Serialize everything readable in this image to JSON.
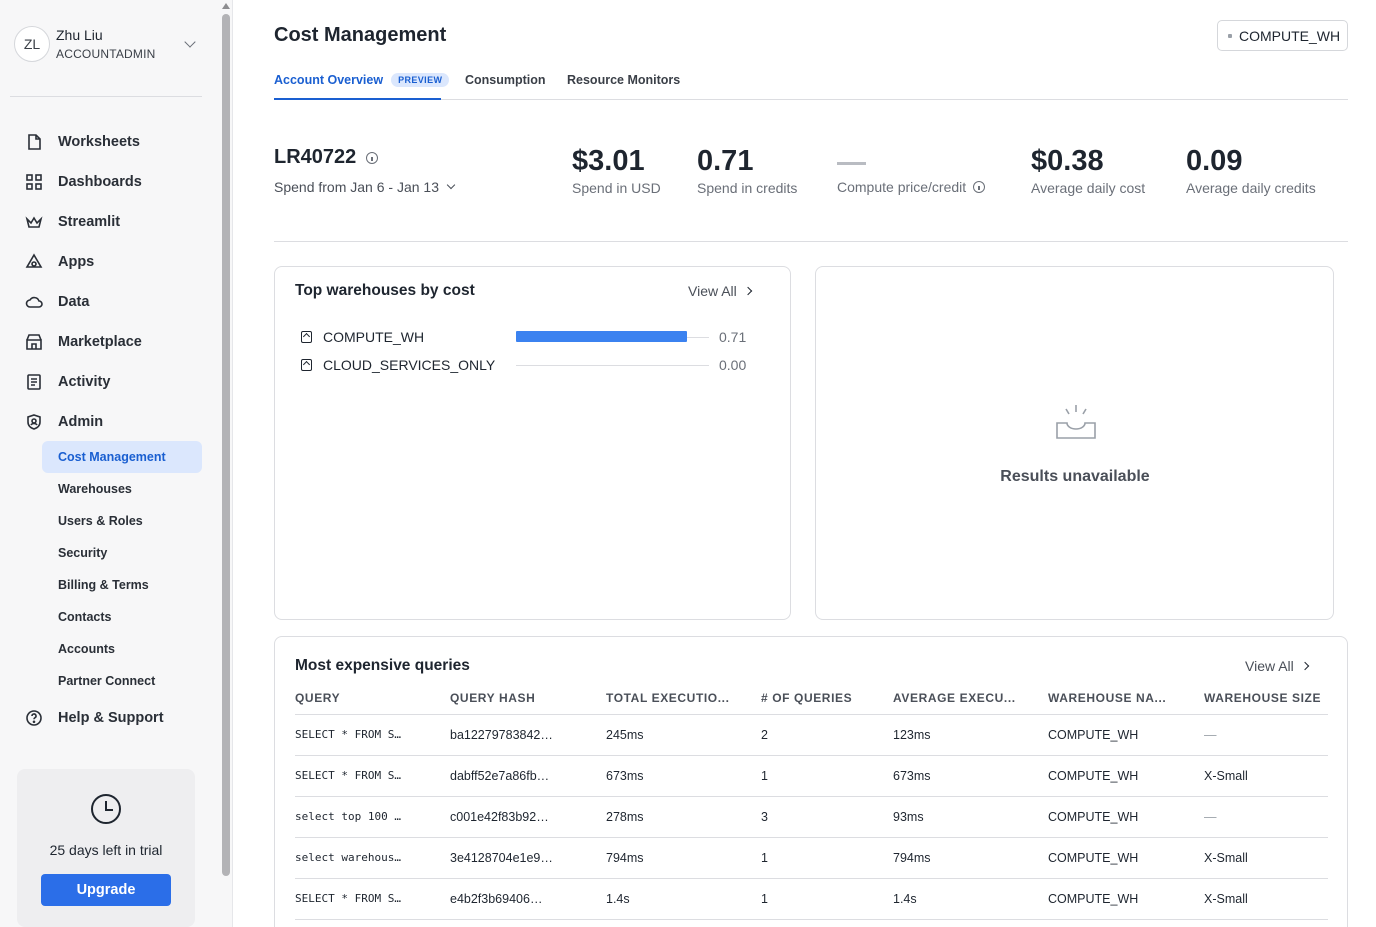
{
  "user": {
    "initials": "ZL",
    "name": "Zhu Liu",
    "role": "ACCOUNTADMIN"
  },
  "nav": [
    {
      "label": "Worksheets",
      "icon": "file-icon"
    },
    {
      "label": "Dashboards",
      "icon": "grid-icon"
    },
    {
      "label": "Streamlit",
      "icon": "crown-icon"
    },
    {
      "label": "Apps",
      "icon": "apps-icon"
    },
    {
      "label": "Data",
      "icon": "cloud-icon"
    },
    {
      "label": "Marketplace",
      "icon": "store-icon"
    },
    {
      "label": "Activity",
      "icon": "activity-icon"
    },
    {
      "label": "Admin",
      "icon": "shield-icon"
    }
  ],
  "admin_sub": [
    {
      "label": "Cost Management",
      "active": true
    },
    {
      "label": "Warehouses"
    },
    {
      "label": "Users & Roles"
    },
    {
      "label": "Security"
    },
    {
      "label": "Billing & Terms"
    },
    {
      "label": "Contacts"
    },
    {
      "label": "Accounts"
    },
    {
      "label": "Partner Connect"
    }
  ],
  "help": {
    "label": "Help & Support",
    "icon": "help-icon"
  },
  "trial": {
    "text": "25 days left in trial",
    "button": "Upgrade"
  },
  "page": {
    "title": "Cost Management",
    "warehouse_selector": "COMPUTE_WH",
    "tabs": [
      {
        "label": "Account Overview",
        "badge": "PREVIEW",
        "active": true
      },
      {
        "label": "Consumption"
      },
      {
        "label": "Resource Monitors"
      }
    ]
  },
  "account": {
    "name": "LR40722",
    "range": "Spend from Jan 6 - Jan 13"
  },
  "stats": [
    {
      "value": "$3.01",
      "label": "Spend in USD"
    },
    {
      "value": "0.71",
      "label": "Spend in credits"
    },
    {
      "value": "",
      "label": "Compute price/credit"
    },
    {
      "value": "$0.38",
      "label": "Average daily cost"
    },
    {
      "value": "0.09",
      "label": "Average daily credits"
    }
  ],
  "top_warehouses": {
    "title": "Top warehouses by cost",
    "view_all": "View All",
    "max": 0.71,
    "items": [
      {
        "name": "COMPUTE_WH",
        "value": 0.71,
        "display": "0.71"
      },
      {
        "name": "CLOUD_SERVICES_ONLY",
        "value": 0.0,
        "display": "0.00"
      }
    ]
  },
  "right_card": {
    "text": "Results unavailable"
  },
  "queries": {
    "title": "Most expensive queries",
    "view_all": "View All",
    "columns": [
      "QUERY",
      "QUERY HASH",
      "TOTAL EXECUTIO...",
      "# OF QUERIES",
      "AVERAGE EXECU...",
      "WAREHOUSE NA...",
      "WAREHOUSE SIZE"
    ],
    "rows": [
      [
        "SELECT * FROM S…",
        "ba12279783842…",
        "245ms",
        "2",
        "123ms",
        "COMPUTE_WH",
        "—"
      ],
      [
        "SELECT * FROM S…",
        "dabff52e7a86fb…",
        "673ms",
        "1",
        "673ms",
        "COMPUTE_WH",
        "X-Small"
      ],
      [
        "select top 100 …",
        "c001e42f83b92…",
        "278ms",
        "3",
        "93ms",
        "COMPUTE_WH",
        "—"
      ],
      [
        "select warehous…",
        "3e4128704e1e9…",
        "794ms",
        "1",
        "794ms",
        "COMPUTE_WH",
        "X-Small"
      ],
      [
        "SELECT * FROM S…",
        "e4b2f3b69406…",
        "1.4s",
        "1",
        "1.4s",
        "COMPUTE_WH",
        "X-Small"
      ]
    ]
  },
  "colors": {
    "accent": "#1a5fd1",
    "bar": "#3b82f0",
    "upgrade": "#2b6ee8"
  }
}
